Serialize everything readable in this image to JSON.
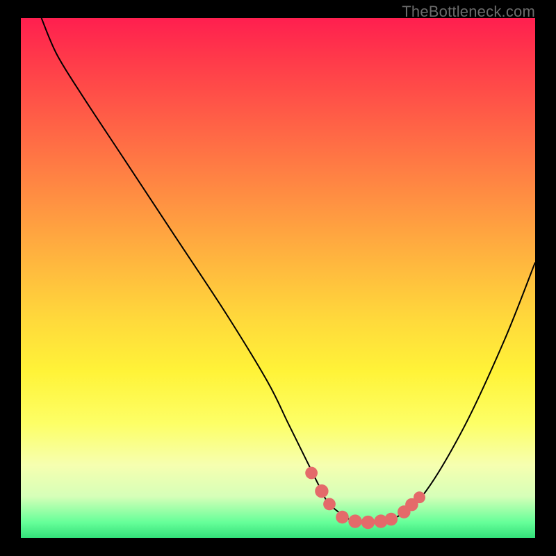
{
  "watermark": "TheBottleneck.com",
  "colors": {
    "frame": "#000000",
    "curve": "#000000",
    "marker_stroke": "#000000",
    "marker_fill": "#e46a6a",
    "gradient_stops": [
      "#ff1f4f",
      "#ff3a4a",
      "#ff5a47",
      "#ff7a44",
      "#ff9a41",
      "#ffba3e",
      "#ffd93b",
      "#fff338",
      "#fdff66",
      "#f6ffb0",
      "#d6ffb8",
      "#66ff99",
      "#33e07a"
    ]
  },
  "chart_data": {
    "type": "line",
    "title": "",
    "xlabel": "",
    "ylabel": "",
    "xlim": [
      0,
      100
    ],
    "ylim": [
      0,
      100
    ],
    "legend": false,
    "grid": false,
    "series": [
      {
        "name": "bottleneck-curve",
        "x": [
          4,
          7,
          12,
          20,
          30,
          40,
          48,
          52,
          56,
          58,
          60,
          64,
          66,
          68,
          72,
          78,
          86,
          94,
          100
        ],
        "y": [
          100,
          93,
          85,
          73,
          58,
          43,
          30,
          22,
          14,
          10,
          6.5,
          3.5,
          3,
          3,
          3.5,
          8,
          21,
          38,
          53
        ]
      }
    ],
    "markers": [
      {
        "name": "marker-left-1",
        "x": 56.5,
        "y": 12.5,
        "r": 1.2
      },
      {
        "name": "marker-left-2",
        "x": 58.5,
        "y": 9.0,
        "r": 1.4
      },
      {
        "name": "marker-left-3",
        "x": 60.0,
        "y": 6.5,
        "r": 1.2
      },
      {
        "name": "marker-bottom-1",
        "x": 62.5,
        "y": 4.0,
        "r": 1.3
      },
      {
        "name": "marker-bottom-2",
        "x": 65.0,
        "y": 3.2,
        "r": 1.4
      },
      {
        "name": "marker-bottom-3",
        "x": 67.5,
        "y": 3.0,
        "r": 1.4
      },
      {
        "name": "marker-bottom-4",
        "x": 70.0,
        "y": 3.2,
        "r": 1.4
      },
      {
        "name": "marker-bottom-5",
        "x": 72.0,
        "y": 3.6,
        "r": 1.3
      },
      {
        "name": "marker-right-1",
        "x": 74.5,
        "y": 5.0,
        "r": 1.3
      },
      {
        "name": "marker-right-2",
        "x": 76.0,
        "y": 6.4,
        "r": 1.3
      },
      {
        "name": "marker-right-3",
        "x": 77.5,
        "y": 7.8,
        "r": 1.1
      }
    ]
  }
}
